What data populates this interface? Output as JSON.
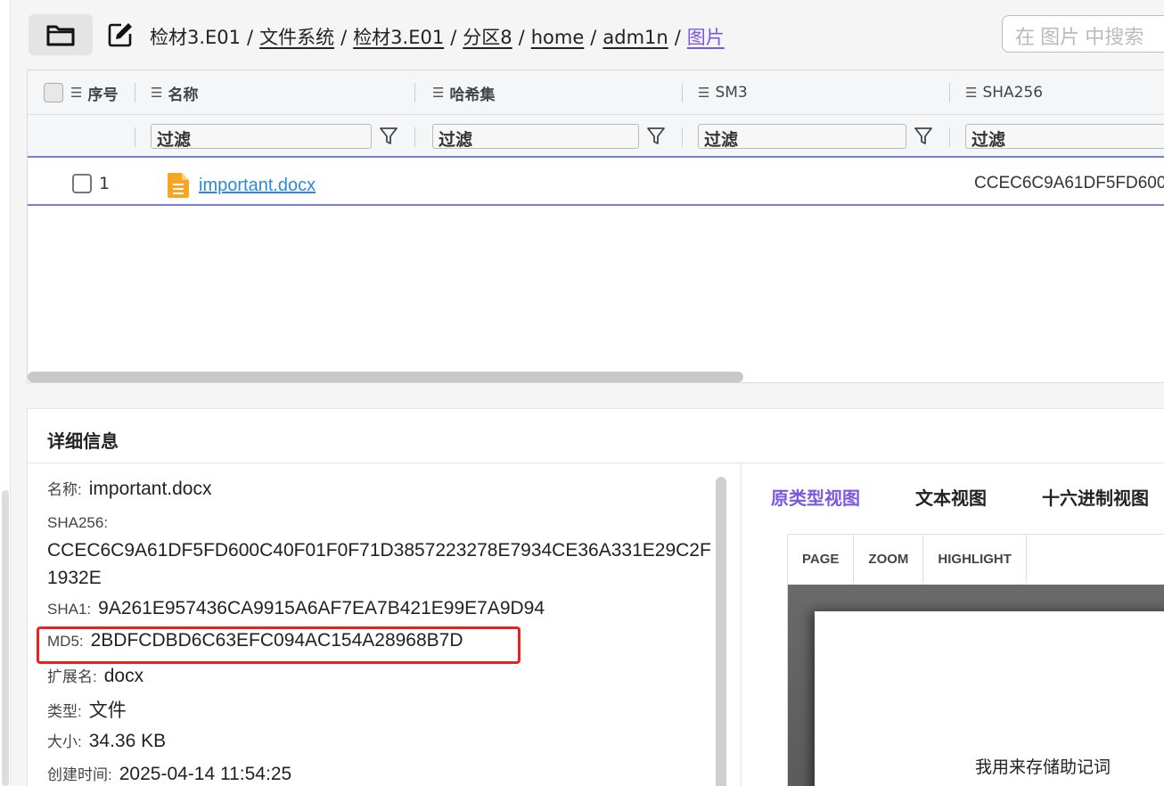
{
  "breadcrumb": {
    "items": [
      "检材3.E01",
      "文件系统",
      "检材3.E01",
      "分区8",
      "home",
      "adm1n",
      "图片"
    ]
  },
  "search": {
    "placeholder": "在 图片 中搜索"
  },
  "grid": {
    "columns": [
      "序号",
      "名称",
      "哈希集",
      "SM3",
      "SHA256"
    ],
    "filter_placeholder": "过滤",
    "rows": [
      {
        "index": "1",
        "name": "important.docx",
        "sha256": "CCEC6C9A61DF5FD600"
      }
    ]
  },
  "detail": {
    "title": "详细信息",
    "fields": {
      "name": {
        "label": "名称:",
        "value": "important.docx"
      },
      "sha256": {
        "label": "SHA256:",
        "value": "CCEC6C9A61DF5FD600C40F01F0F71D3857223278E7934CE36A331E29C2F1932E"
      },
      "sha1": {
        "label": "SHA1:",
        "value": "9A261E957436CA9915A6AF7EA7B421E99E7A9D94"
      },
      "md5": {
        "label": "MD5:",
        "value": "2BDFCDBD6C63EFC094AC154A28968B7D"
      },
      "ext": {
        "label": "扩展名:",
        "value": "docx"
      },
      "type": {
        "label": "类型:",
        "value": "文件"
      },
      "size": {
        "label": "大小:",
        "value": "34.36 KB"
      },
      "created": {
        "label": "创建时间:",
        "value": "2025-04-14 11:54:25"
      }
    },
    "tabs": [
      "原类型视图",
      "文本视图",
      "十六进制视图"
    ],
    "viewer": {
      "tools": [
        "PAGE",
        "ZOOM",
        "HIGHLIGHT"
      ],
      "page_text": "我用来存储助记词"
    }
  },
  "colors": {
    "accent": "#7b57e4",
    "link": "#2a8ad8",
    "highlight_box": "#e8231d"
  }
}
